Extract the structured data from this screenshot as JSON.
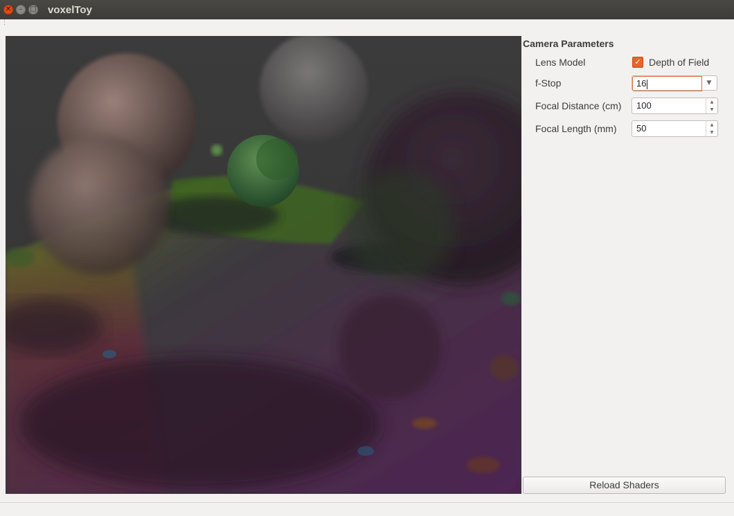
{
  "window": {
    "title": "voxelToy",
    "controls": {
      "close_icon": "close-icon",
      "minimize_icon": "minimize-icon",
      "maximize_icon": "maximize-icon"
    }
  },
  "viewport": {
    "description_icon": "render-viewport"
  },
  "camera_parameters": {
    "title": "Camera Parameters",
    "lens_model": {
      "label": "Lens Model",
      "checkbox_label": "Depth of Field",
      "checked": true
    },
    "f_stop": {
      "label": "f-Stop",
      "value": "16"
    },
    "focal_distance": {
      "label": "Focal Distance (cm)",
      "value": "100"
    },
    "focal_length": {
      "label": "Focal Length (mm)",
      "value": "50"
    }
  },
  "actions": {
    "reload_shaders": "Reload Shaders"
  },
  "colors": {
    "accent": "#e7652b",
    "titlebar": "#3c3b37",
    "panel_bg": "#f2f1f0"
  }
}
